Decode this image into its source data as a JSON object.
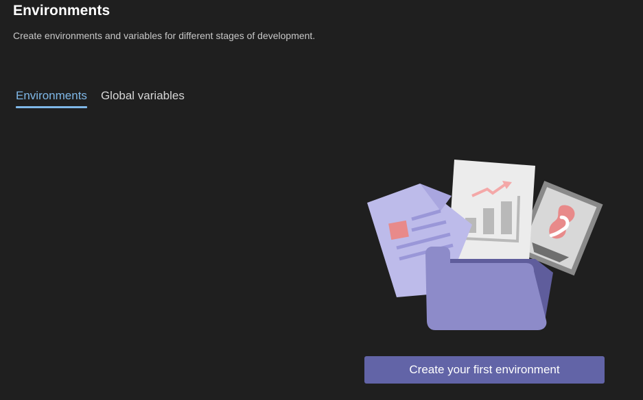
{
  "header": {
    "title": "Environments",
    "subtitle": "Create environments and variables for different stages of development."
  },
  "tabs": [
    {
      "label": "Environments",
      "active": true
    },
    {
      "label": "Global variables",
      "active": false
    }
  ],
  "empty_state": {
    "illustration": "folder-with-documents-illustration",
    "button_label": "Create your first environment"
  },
  "colors": {
    "background": "#1f1f1f",
    "accent": "#6264a7",
    "active_tab": "#7fb8e8"
  }
}
